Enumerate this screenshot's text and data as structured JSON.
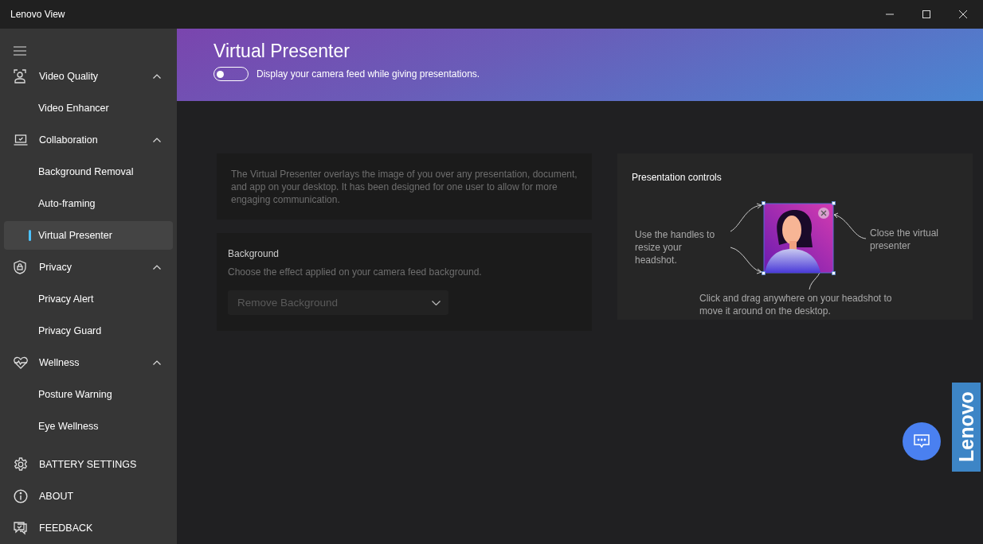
{
  "window": {
    "title": "Lenovo View"
  },
  "sidebar": {
    "groups": [
      {
        "label": "Video Quality",
        "expanded": true,
        "items": [
          {
            "label": "Video Enhancer",
            "selected": false
          }
        ]
      },
      {
        "label": "Collaboration",
        "expanded": true,
        "items": [
          {
            "label": "Background Removal",
            "selected": false
          },
          {
            "label": "Auto-framing",
            "selected": false
          },
          {
            "label": "Virtual Presenter",
            "selected": true
          }
        ]
      },
      {
        "label": "Privacy",
        "expanded": true,
        "items": [
          {
            "label": "Privacy Alert",
            "selected": false
          },
          {
            "label": "Privacy Guard",
            "selected": false
          }
        ]
      },
      {
        "label": "Wellness",
        "expanded": true,
        "items": [
          {
            "label": "Posture Warning",
            "selected": false
          },
          {
            "label": "Eye Wellness",
            "selected": false
          }
        ]
      }
    ],
    "footer": [
      {
        "label": "BATTERY SETTINGS"
      },
      {
        "label": "ABOUT"
      },
      {
        "label": "FEEDBACK"
      }
    ]
  },
  "header": {
    "title": "Virtual Presenter",
    "toggle": {
      "on": false,
      "label": "Display your camera feed while giving presentations."
    }
  },
  "description": "The Virtual Presenter overlays the image of you over any presentation, document, and app on your desktop. It has been designed for one user to allow for more engaging communication.",
  "background_card": {
    "title": "Background",
    "subtitle": "Choose the effect applied on your camera feed background.",
    "dropdown": {
      "value": "Remove Background",
      "disabled": true
    }
  },
  "presentation_controls": {
    "title": "Presentation controls",
    "callouts": [
      "Use the handles to resize your headshot.",
      "Close the virtual presenter",
      "Click and drag anywhere on your headshot to move it around on the desktop."
    ]
  },
  "logo": "Lenovo"
}
